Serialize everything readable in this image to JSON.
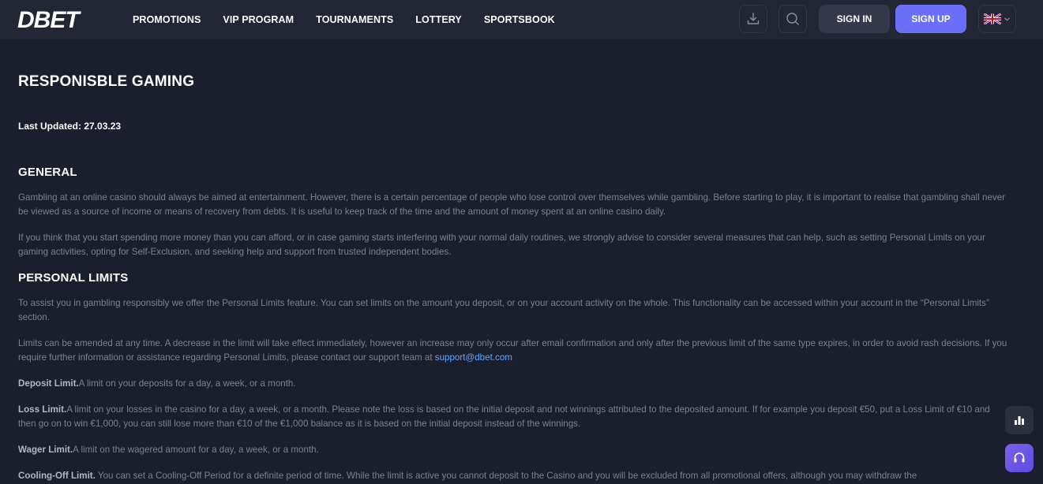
{
  "header": {
    "logo_text": "DBET",
    "nav": [
      "PROMOTIONS",
      "VIP PROGRAM",
      "TOURNAMENTS",
      "LOTTERY",
      "SPORTSBOOK"
    ],
    "sign_in": "SIGN IN",
    "sign_up": "SIGN UP",
    "icons": {
      "download": "download-icon",
      "search": "search-icon",
      "language": "uk-flag-icon",
      "chevron": "chevron-down-icon"
    }
  },
  "page": {
    "title": "RESPONISBLE GAMING",
    "updated": "Last Updated: 27.03.23",
    "general": {
      "heading": "GENERAL",
      "p1": "Gambling at an online casino should always be aimed at entertainment. However, there is a certain percentage of people who lose control over themselves while gambling. Before starting to play, it is important to realise that gambling shall never be viewed as a source of income or means of recovery from debts. It is useful to keep track of the time and the amount of money spent at an online casino daily.",
      "p2": "If you think that you start spending more money than you can afford, or in case gaming starts interfering with your normal daily routines, we strongly advise to consider several measures that can help, such as setting Personal Limits on your gaming activities, opting for Self-Exclusion, and seeking help and support from trusted independent bodies."
    },
    "limits": {
      "heading": "PERSONAL LIMITS",
      "p1": "To assist you in gambling responsibly we offer the Personal Limits feature. You can set limits on the amount you deposit, or on your account activity on the whole. This functionality can be accessed within your account in the “Personal Limits” section.",
      "p2": "Limits can be amended at any time. A decrease in the limit will take effect immediately, however an increase may only occur after email confirmation and only after the previous limit of the same type expires, in order to avoid rash decisions. If you require further information or assistance regarding Personal Limits, please contact our support team at ",
      "support_email": "support@dbet.com",
      "deposit_label": "Deposit Limit.",
      "deposit_text": "A limit on your deposits for a day, a week, or a month.",
      "loss_label": "Loss Limit.",
      "loss_text": "A limit on your losses in the casino for a day, a week, or a month. Please note the loss is based on the initial deposit and not winnings attributed to the deposited amount. If for example you deposit €50, put a Loss Limit of €10 and then go on to win €1,000, you can still lose more than €10 of the €1,000 balance as it is based on the initial deposit instead of the winnings.",
      "wager_label": "Wager Limit.",
      "wager_text": "A limit on the wagered amount for a day, a week, or a month.",
      "cooling_label": "Cooling-Off Limit.",
      "cooling_text": " You can set a Cooling-Off Period for a definite period of time. While the limit is active you cannot deposit to the Casino and you will be excluded from all promotional offers, although you may withdraw the"
    }
  },
  "floating": {
    "stats_icon": "bar-chart-icon",
    "support_icon": "headset-icon"
  },
  "colors": {
    "background": "#1b1e2c",
    "header": "#232735",
    "accent": "#6a6ff7",
    "link": "#5aa9ff",
    "body_text": "#7c8190"
  }
}
